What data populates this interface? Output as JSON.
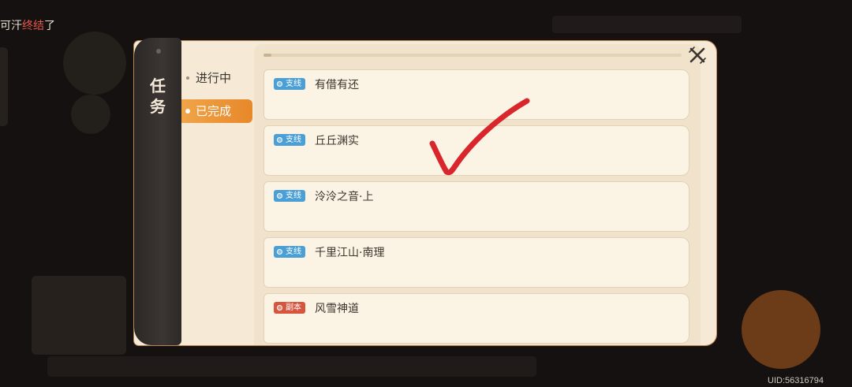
{
  "background": {
    "top_text_before": "可汗",
    "top_text_highlight": "终结",
    "top_text_after": "了",
    "uid": "UID:56316794"
  },
  "panel": {
    "title": "任务",
    "tabs": [
      {
        "label": "进行中",
        "active": false
      },
      {
        "label": "已完成",
        "active": true
      }
    ]
  },
  "quests": [
    {
      "tag": "支线",
      "type": "side",
      "name": "有借有还"
    },
    {
      "tag": "支线",
      "type": "side",
      "name": "丘丘渊实"
    },
    {
      "tag": "支线",
      "type": "side",
      "name": "泠泠之音·上"
    },
    {
      "tag": "支线",
      "type": "side",
      "name": "千里江山·南理"
    },
    {
      "tag": "副本",
      "type": "dungeon",
      "name": "风雪神道"
    }
  ],
  "colors": {
    "accent": "#e7882a",
    "side_tag": "#4a9fd6",
    "dungeon_tag": "#d6553f",
    "check_mark": "#d8262c"
  }
}
